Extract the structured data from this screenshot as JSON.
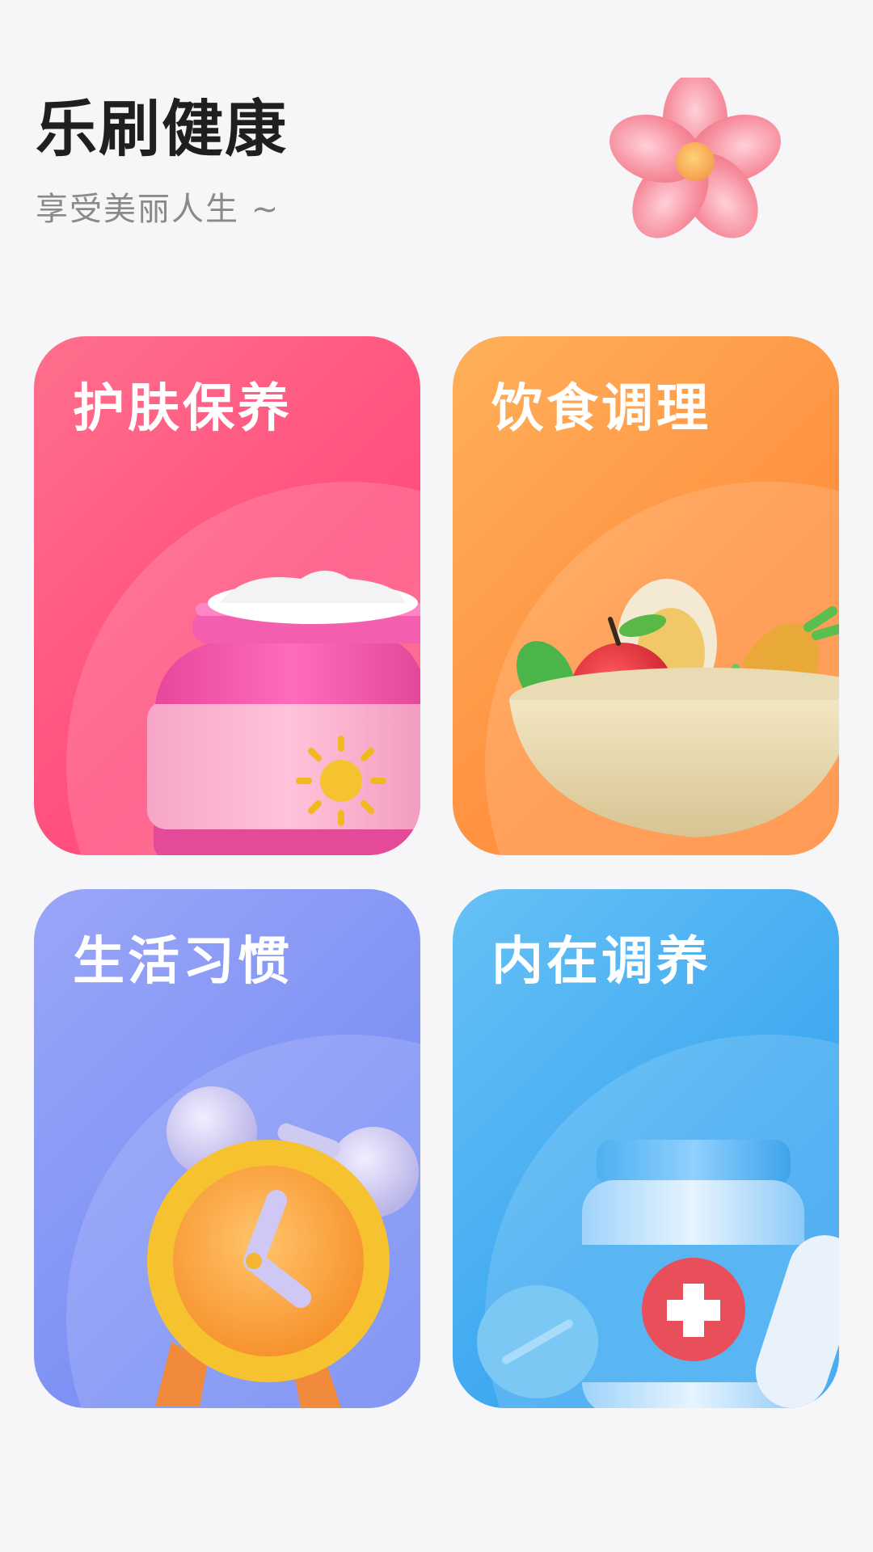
{
  "header": {
    "title": "乐刷健康",
    "subtitle": "享受美丽人生 ~"
  },
  "cards": [
    {
      "label": "护肤保养",
      "icon": "cream-jar-icon",
      "color": "#ff5a84"
    },
    {
      "label": "饮食调理",
      "icon": "fruit-bowl-icon",
      "color": "#ff9140"
    },
    {
      "label": "生活习惯",
      "icon": "alarm-clock-icon",
      "color": "#7e92f5"
    },
    {
      "label": "内在调养",
      "icon": "medicine-bottle-icon",
      "color": "#3fa9f1"
    }
  ],
  "decor": {
    "icon": "flower-icon"
  }
}
